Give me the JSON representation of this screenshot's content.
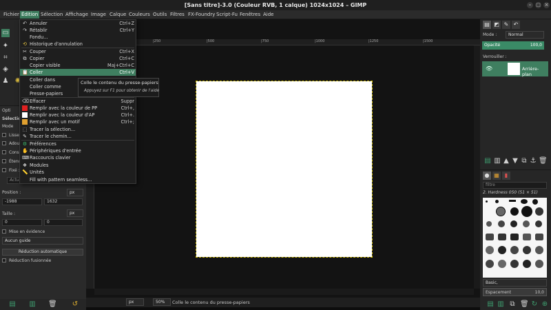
{
  "window": {
    "title": "[Sans titre]-3.0 (Couleur RVB, 1 calque) 1024x1024 – GIMP",
    "controls": [
      "–",
      "□",
      "×"
    ]
  },
  "menubar": [
    "Fichier",
    "Édition",
    "Sélection",
    "Affichage",
    "Image",
    "Calque",
    "Couleurs",
    "Outils",
    "Filtres",
    "FX-Foundry",
    "Script-Fu",
    "Fenêtres",
    "Aide"
  ],
  "edit_menu": {
    "items": [
      {
        "label": "Annuler",
        "shortcut": "Ctrl+Z",
        "icon": "undo-icon"
      },
      {
        "label": "Rétablir",
        "shortcut": "Ctrl+Y",
        "icon": "redo-icon"
      },
      {
        "label": "Fondu...",
        "shortcut": "",
        "icon": "fade-icon"
      },
      {
        "label": "Historique d'annulation",
        "shortcut": "",
        "icon": "history-icon"
      },
      {
        "label": "Couper",
        "shortcut": "Ctrl+X",
        "icon": "cut-icon"
      },
      {
        "label": "Copier",
        "shortcut": "Ctrl+C",
        "icon": "copy-icon"
      },
      {
        "label": "Copier visible",
        "shortcut": "Maj+Ctrl+C",
        "icon": "copy-visible-icon"
      },
      {
        "label": "Coller",
        "shortcut": "Ctrl+V",
        "icon": "paste-icon"
      },
      {
        "label": "Coller dans",
        "shortcut": "",
        "icon": ""
      },
      {
        "label": "Coller comme",
        "shortcut": "",
        "icon": ""
      },
      {
        "label": "Presse-papiers",
        "shortcut": "",
        "icon": ""
      },
      {
        "label": "Effacer",
        "shortcut": "Suppr",
        "icon": "clear-icon"
      },
      {
        "label": "Remplir avec la couleur de PP",
        "shortcut": "Ctrl+,",
        "icon": "fill-fg-icon"
      },
      {
        "label": "Remplir avec la couleur d'AP",
        "shortcut": "Ctrl+.",
        "icon": "fill-bg-icon"
      },
      {
        "label": "Remplir avec un motif",
        "shortcut": "Ctrl+;",
        "icon": "fill-pattern-icon"
      },
      {
        "label": "Tracer la sélection...",
        "shortcut": "",
        "icon": "stroke-selection-icon"
      },
      {
        "label": "Tracer le chemin...",
        "shortcut": "",
        "icon": "stroke-path-icon"
      },
      {
        "label": "Préférences",
        "shortcut": "",
        "icon": "preferences-icon"
      },
      {
        "label": "Périphériques d'entrée",
        "shortcut": "",
        "icon": "input-devices-icon"
      },
      {
        "label": "Raccourcis clavier",
        "shortcut": "",
        "icon": "keyboard-icon"
      },
      {
        "label": "Modules",
        "shortcut": "",
        "icon": "modules-icon"
      },
      {
        "label": "Unités",
        "shortcut": "",
        "icon": "units-icon"
      },
      {
        "label": "Fill with pattern seamless...",
        "shortcut": "",
        "icon": ""
      }
    ]
  },
  "tooltip": {
    "main": "Colle le contenu du presse-papiers",
    "hint": "Appuyez sur F1 pour obtenir de l'aide"
  },
  "tool_options": {
    "header": "Opti",
    "selection_label": "Sélectio",
    "mode_label": "Mode",
    "rows": [
      "Lisse",
      "Adou",
      "Conse",
      "Étend",
      "Fixé :"
    ],
    "actual_label": "Actue",
    "position_label": "Position :",
    "position_unit": "px",
    "position_x": "-1988",
    "position_y": "1632",
    "size_label": "Taille :",
    "size_unit": "px",
    "size_w": "0",
    "size_h": "0",
    "highlight_label": "Mise en évidence",
    "guides_value": "Aucun guide",
    "auto_shrink": "Réduction automatique",
    "shrink_merged": "Réduction fusionnée"
  },
  "rulers": [
    "|250",
    "|500",
    "|750",
    "|1000",
    "|1250",
    "|1500"
  ],
  "status": {
    "unit": "px",
    "zoom": "50%",
    "message": "Colle le contenu du presse-papiers"
  },
  "layers": {
    "mode_label": "Mode :",
    "mode_value": "Normal",
    "opacity_label": "Opacité",
    "opacity_value": "100,0",
    "lock_label": "Verrouiller :",
    "layer_name": "Arrière-plan"
  },
  "brushes": {
    "filter_placeholder": "filtre",
    "current": "2. Hardness 050 (51 × 51)",
    "tag": "Basic,",
    "spacing_label": "Espacement",
    "spacing_value": "10,0"
  },
  "colors": {
    "accent": "#3f7f60",
    "opacity_fill": "#3a8a66",
    "selection_outline": "#c8b400"
  }
}
